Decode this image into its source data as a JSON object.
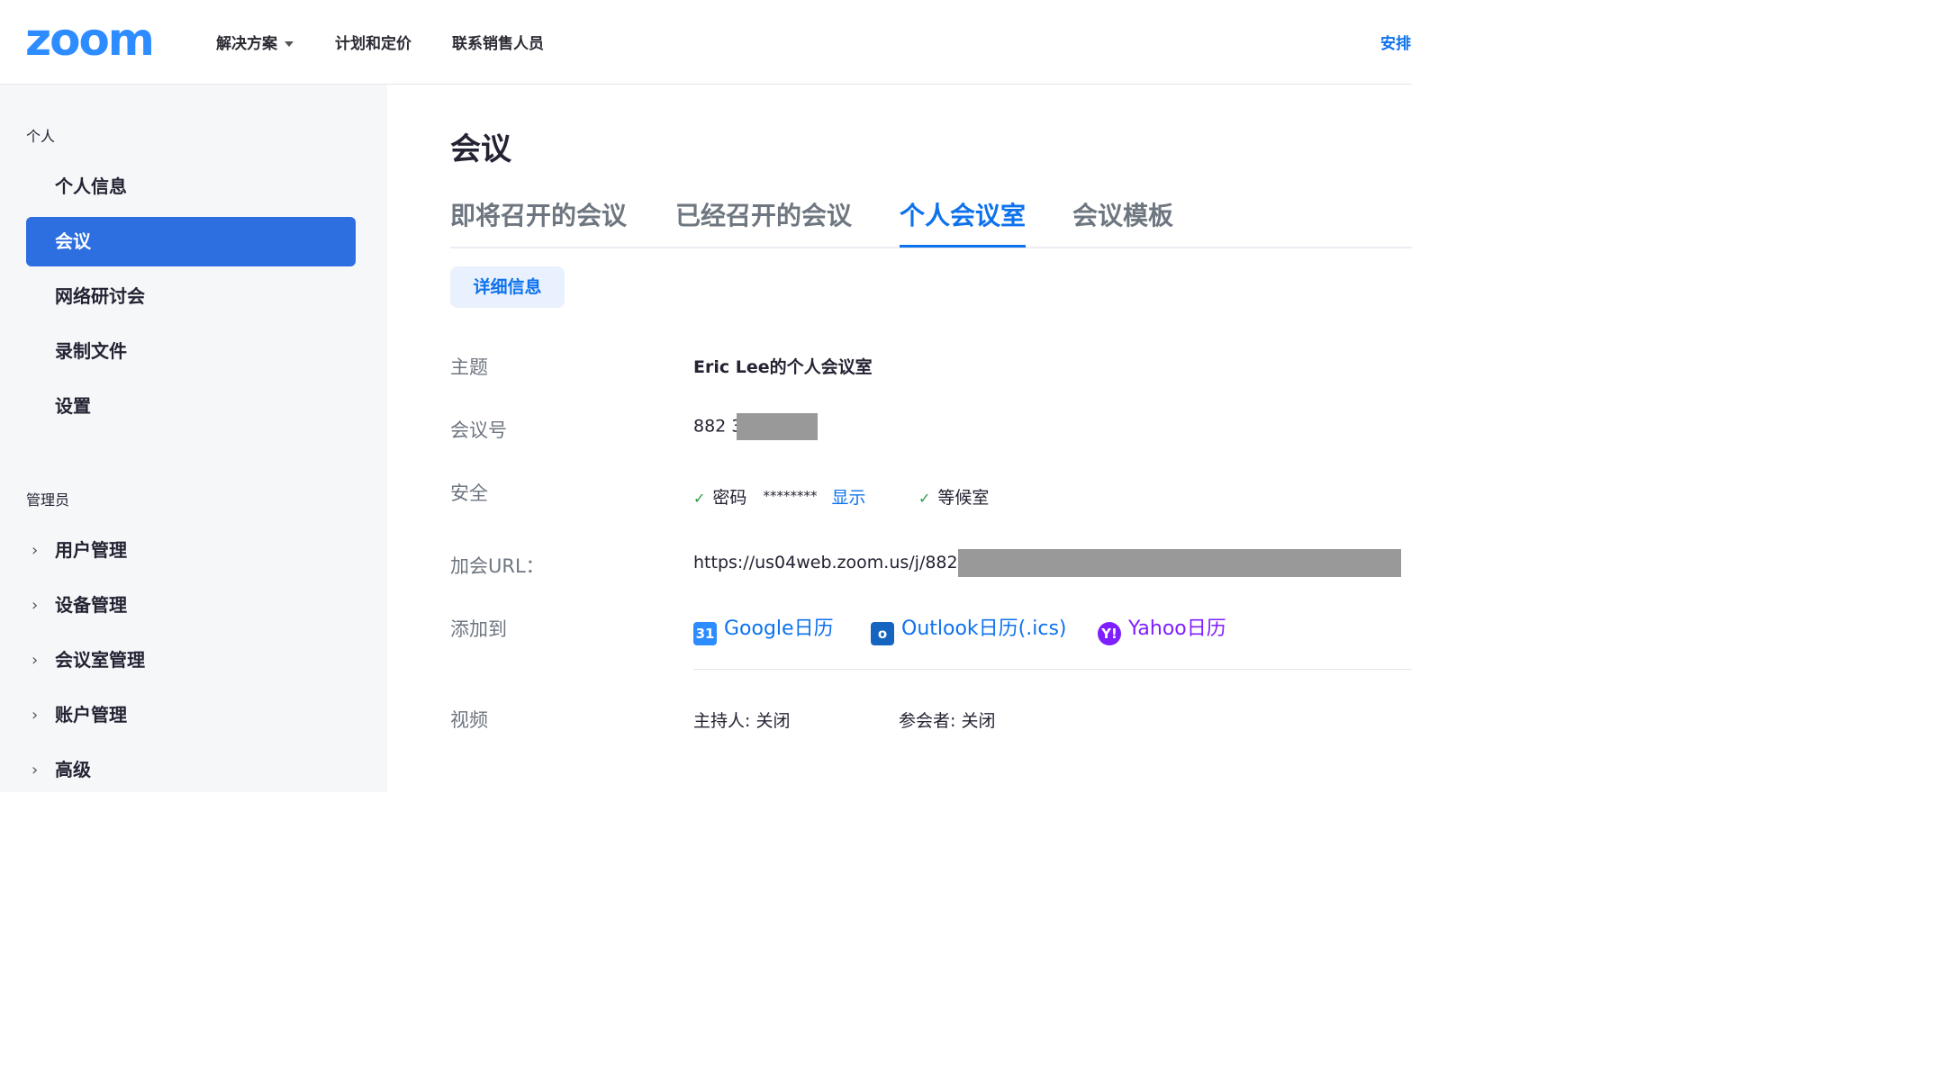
{
  "header": {
    "logo_text": "zoom",
    "nav": {
      "solutions": "解决方案",
      "plans": "计划和定价",
      "contact_sales": "联系销售人员"
    },
    "schedule": "安排"
  },
  "sidebar": {
    "personal_section": "个人",
    "personal_items": [
      "个人信息",
      "会议",
      "网络研讨会",
      "录制文件",
      "设置"
    ],
    "active_item": "会议",
    "admin_section": "管理员",
    "admin_items": [
      "用户管理",
      "设备管理",
      "会议室管理",
      "账户管理",
      "高级"
    ]
  },
  "main": {
    "title": "会议",
    "tabs": [
      "即将召开的会议",
      "已经召开的会议",
      "个人会议室",
      "会议模板"
    ],
    "active_tab": "个人会议室",
    "detail_button": "详细信息",
    "rows": {
      "topic": {
        "label": "主题",
        "value": "Eric Lee的个人会议室"
      },
      "meeting_id": {
        "label": "会议号",
        "value": "882 3"
      },
      "security": {
        "label": "安全",
        "password_label": "密码",
        "password_mask": "********",
        "show_link": "显示",
        "waiting_room": "等候室"
      },
      "join_url": {
        "label": "加会URL：",
        "value": "https://us04web.zoom.us/j/882"
      },
      "add_to": {
        "label": "添加到",
        "google": "Google日历",
        "outlook": "Outlook日历(.ics)",
        "yahoo": "Yahoo日历"
      },
      "video": {
        "label": "视频",
        "host": "主持人: 关闭",
        "participant": "参会者: 关闭"
      }
    }
  },
  "colors": {
    "brand": "#2d8cff",
    "active_nav": "#2d6ee0",
    "link": "#0e72ed",
    "yahoo": "#7e1fff",
    "redaction": "#999999"
  },
  "icons": {
    "calendar_google": "calendar-31-icon",
    "calendar_outlook": "outlook-icon",
    "calendar_yahoo": "yahoo-icon",
    "check": "check-icon",
    "chevron": "chevron-right-icon",
    "caret": "caret-down-icon"
  }
}
